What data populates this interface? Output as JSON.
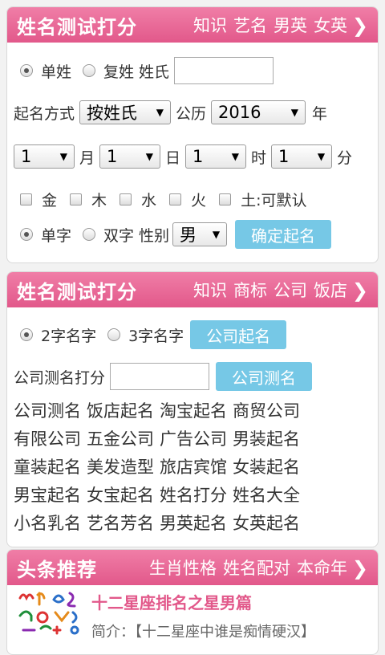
{
  "card1": {
    "title": "姓名测试打分",
    "links": [
      "知识",
      "艺名",
      "男英",
      "女英"
    ],
    "row1": {
      "single": "单姓",
      "double": "复姓",
      "surname_label": "姓氏",
      "surname_value": ""
    },
    "row2": {
      "mode_label": "起名方式",
      "mode_value": "按姓氏",
      "calendar_label": "公历",
      "year_value": "2016",
      "year_unit": "年"
    },
    "row3": {
      "month_value": "1",
      "month_unit": "月",
      "day_value": "1",
      "day_unit": "日",
      "hour_value": "1",
      "hour_unit": "时",
      "minute_value": "1",
      "minute_unit": "分"
    },
    "elements": [
      "金",
      "木",
      "水",
      "火",
      "土:可默认"
    ],
    "row5": {
      "single_char": "单字",
      "double_char": "双字",
      "gender_label": "性别",
      "gender_value": "男",
      "submit": "确定起名"
    }
  },
  "card2": {
    "title": "姓名测试打分",
    "links": [
      "知识",
      "商标",
      "公司",
      "饭店"
    ],
    "row1": {
      "two": "2字名字",
      "three": "3字名字",
      "button": "公司起名"
    },
    "row2": {
      "label": "公司测名打分",
      "value": "",
      "button": "公司测名"
    },
    "words": [
      [
        "公司测名",
        "饭店起名",
        "淘宝起名",
        "商贸公司"
      ],
      [
        "有限公司",
        "五金公司",
        "广告公司",
        "男装起名"
      ],
      [
        "童装起名",
        "美发造型",
        "旅店宾馆",
        "女装起名"
      ],
      [
        "男宝起名",
        "女宝起名",
        "姓名打分",
        "姓名大全"
      ],
      [
        "小名乳名",
        "艺名芳名",
        "男英起名",
        "女英起名"
      ]
    ]
  },
  "card3": {
    "title": "头条推荐",
    "links": [
      "生肖性格",
      "姓名配对",
      "本命年"
    ],
    "news_title": "十二星座排名之星男篇",
    "news_intro": "简介：【十二星座中谁是痴情硬汉】"
  },
  "colors": {
    "accent": "#e2588a",
    "button": "#76c8e6"
  }
}
